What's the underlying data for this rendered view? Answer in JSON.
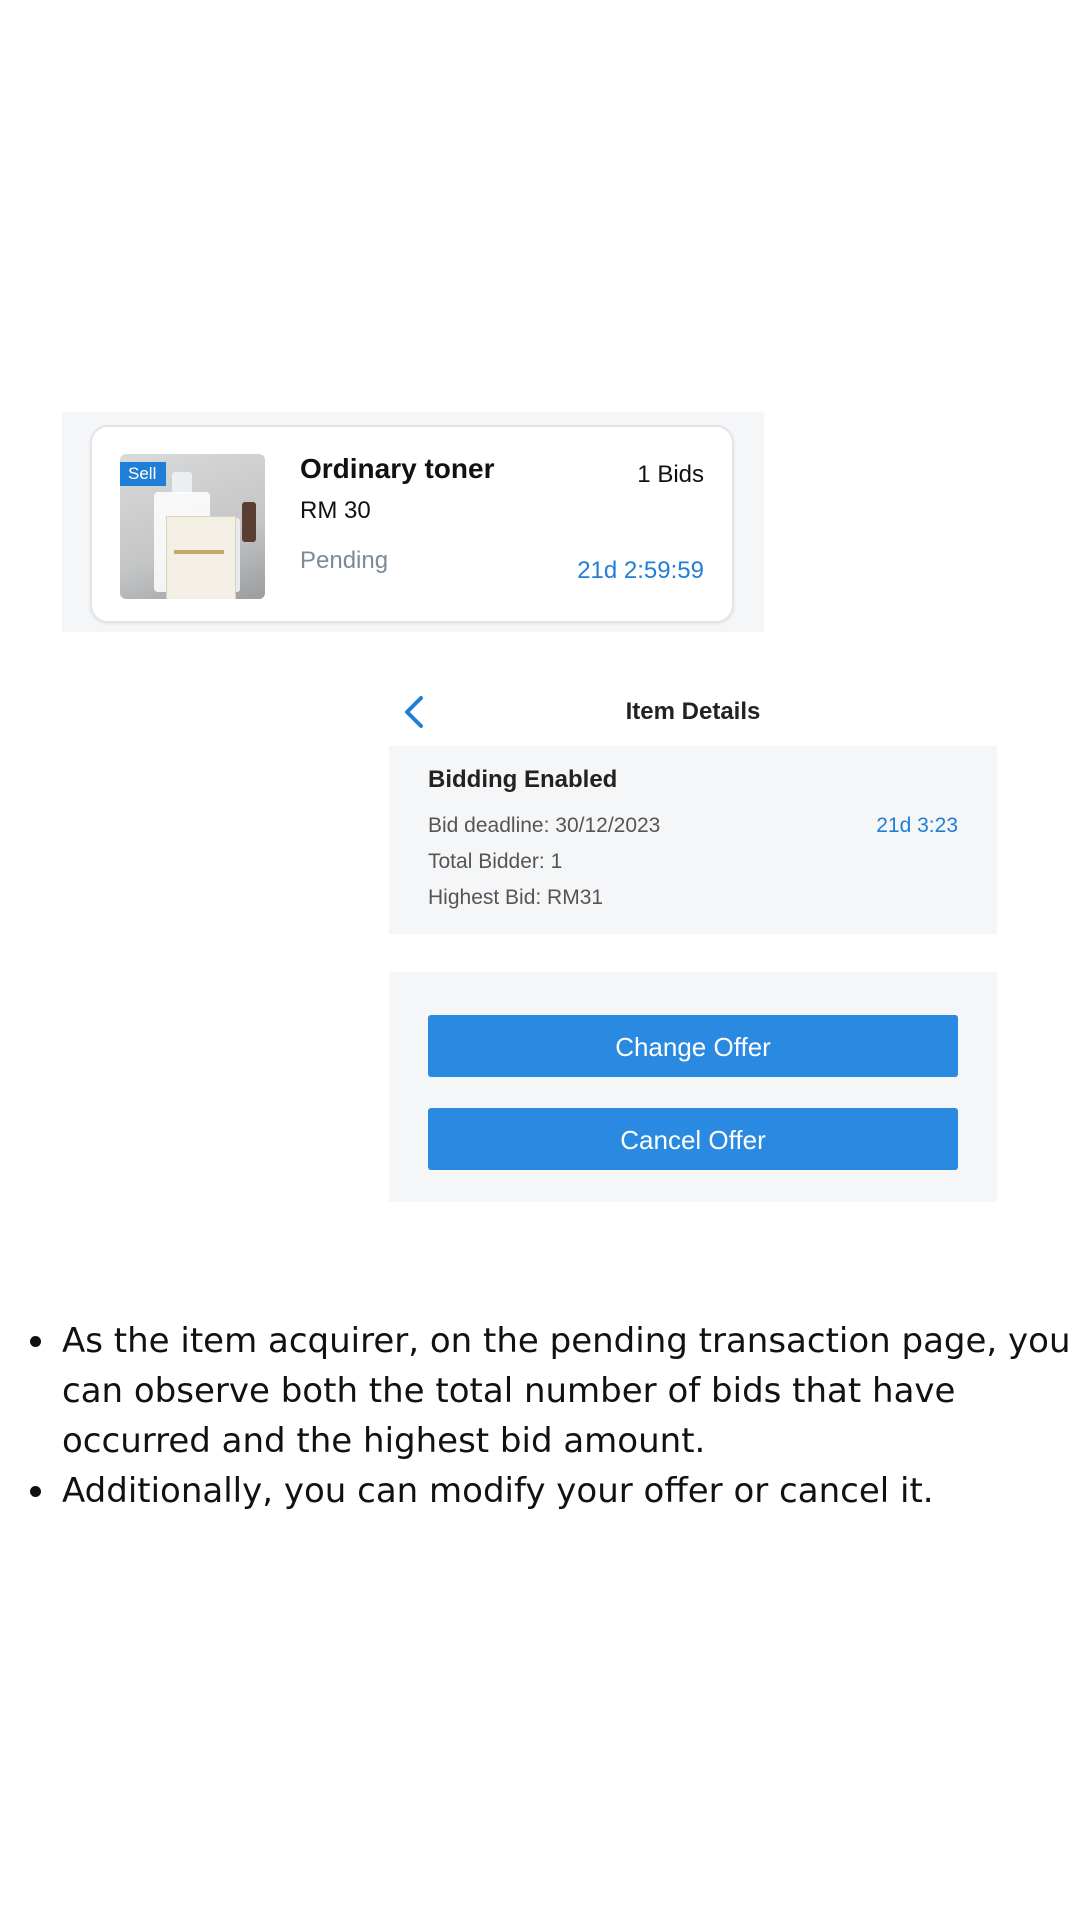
{
  "listing": {
    "tag": "Sell",
    "name": "Ordinary toner",
    "price": "RM 30",
    "status": "Pending",
    "bids": "1 Bids",
    "timer": "21d 2:59:59"
  },
  "details": {
    "nav_title": "Item Details",
    "bidding_title": "Bidding Enabled",
    "deadline": "Bid deadline: 30/12/2023",
    "deadline_timer": "21d 3:23",
    "total_bidder": "Total Bidder: 1",
    "highest_bid": "Highest Bid: RM31",
    "change_offer": "Change Offer",
    "cancel_offer": "Cancel Offer"
  },
  "notes": [
    "As the item acquirer, on the pending transaction page, you can observe both the total number of bids that have occurred and the highest bid amount.",
    "Additionally, you can modify your offer or cancel it."
  ],
  "colors": {
    "accent": "#1f7fd6",
    "button": "#2a89e0",
    "panel_bg": "#f5f6f8",
    "muted": "#7e8a99"
  },
  "icons": {
    "back": "chevron-left-icon"
  }
}
